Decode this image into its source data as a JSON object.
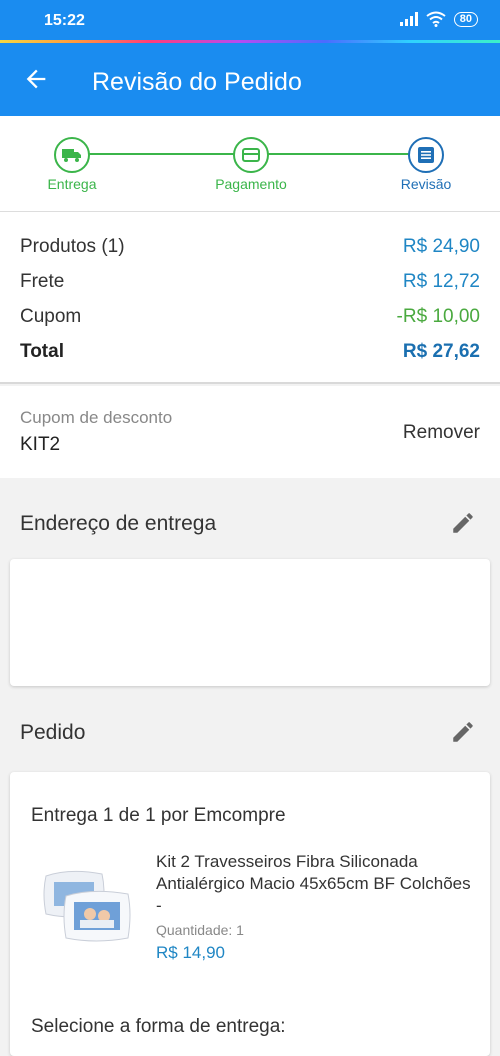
{
  "status_bar": {
    "time": "15:22",
    "battery": "80"
  },
  "header": {
    "title": "Revisão do Pedido",
    "back_icon": "arrow-left-icon"
  },
  "stepper": {
    "steps": [
      {
        "label": "Entrega",
        "icon": "truck-icon",
        "state": "done"
      },
      {
        "label": "Pagamento",
        "icon": "card-icon",
        "state": "done"
      },
      {
        "label": "Revisão",
        "icon": "list-icon",
        "state": "active"
      }
    ],
    "colors": {
      "done": "#3bb54a",
      "active": "#1f6fb6"
    }
  },
  "summary": {
    "products_label": "Produtos (1)",
    "products_value": "R$ 24,90",
    "shipping_label": "Frete",
    "shipping_value": "R$ 12,72",
    "coupon_label": "Cupom",
    "coupon_value": "-R$ 10,00",
    "total_label": "Total",
    "total_value": "R$ 27,62"
  },
  "coupon": {
    "label": "Cupom de desconto",
    "code": "KIT2",
    "remove_label": "Remover"
  },
  "address": {
    "title": "Endereço de entrega"
  },
  "order": {
    "title": "Pedido",
    "delivery_title": "Entrega 1 de 1 por Emcompre",
    "product": {
      "name": "Kit 2 Travesseiros Fibra Siliconada Antialérgico Macio 45x65cm BF Colchões -",
      "quantity": "Quantidade:  1",
      "price": "R$ 14,90"
    },
    "shipping_method_title": "Selecione a forma de entrega:"
  },
  "colors": {
    "primary": "#1a8cf0",
    "price": "#1f86c4",
    "discount": "#4aa93f"
  }
}
